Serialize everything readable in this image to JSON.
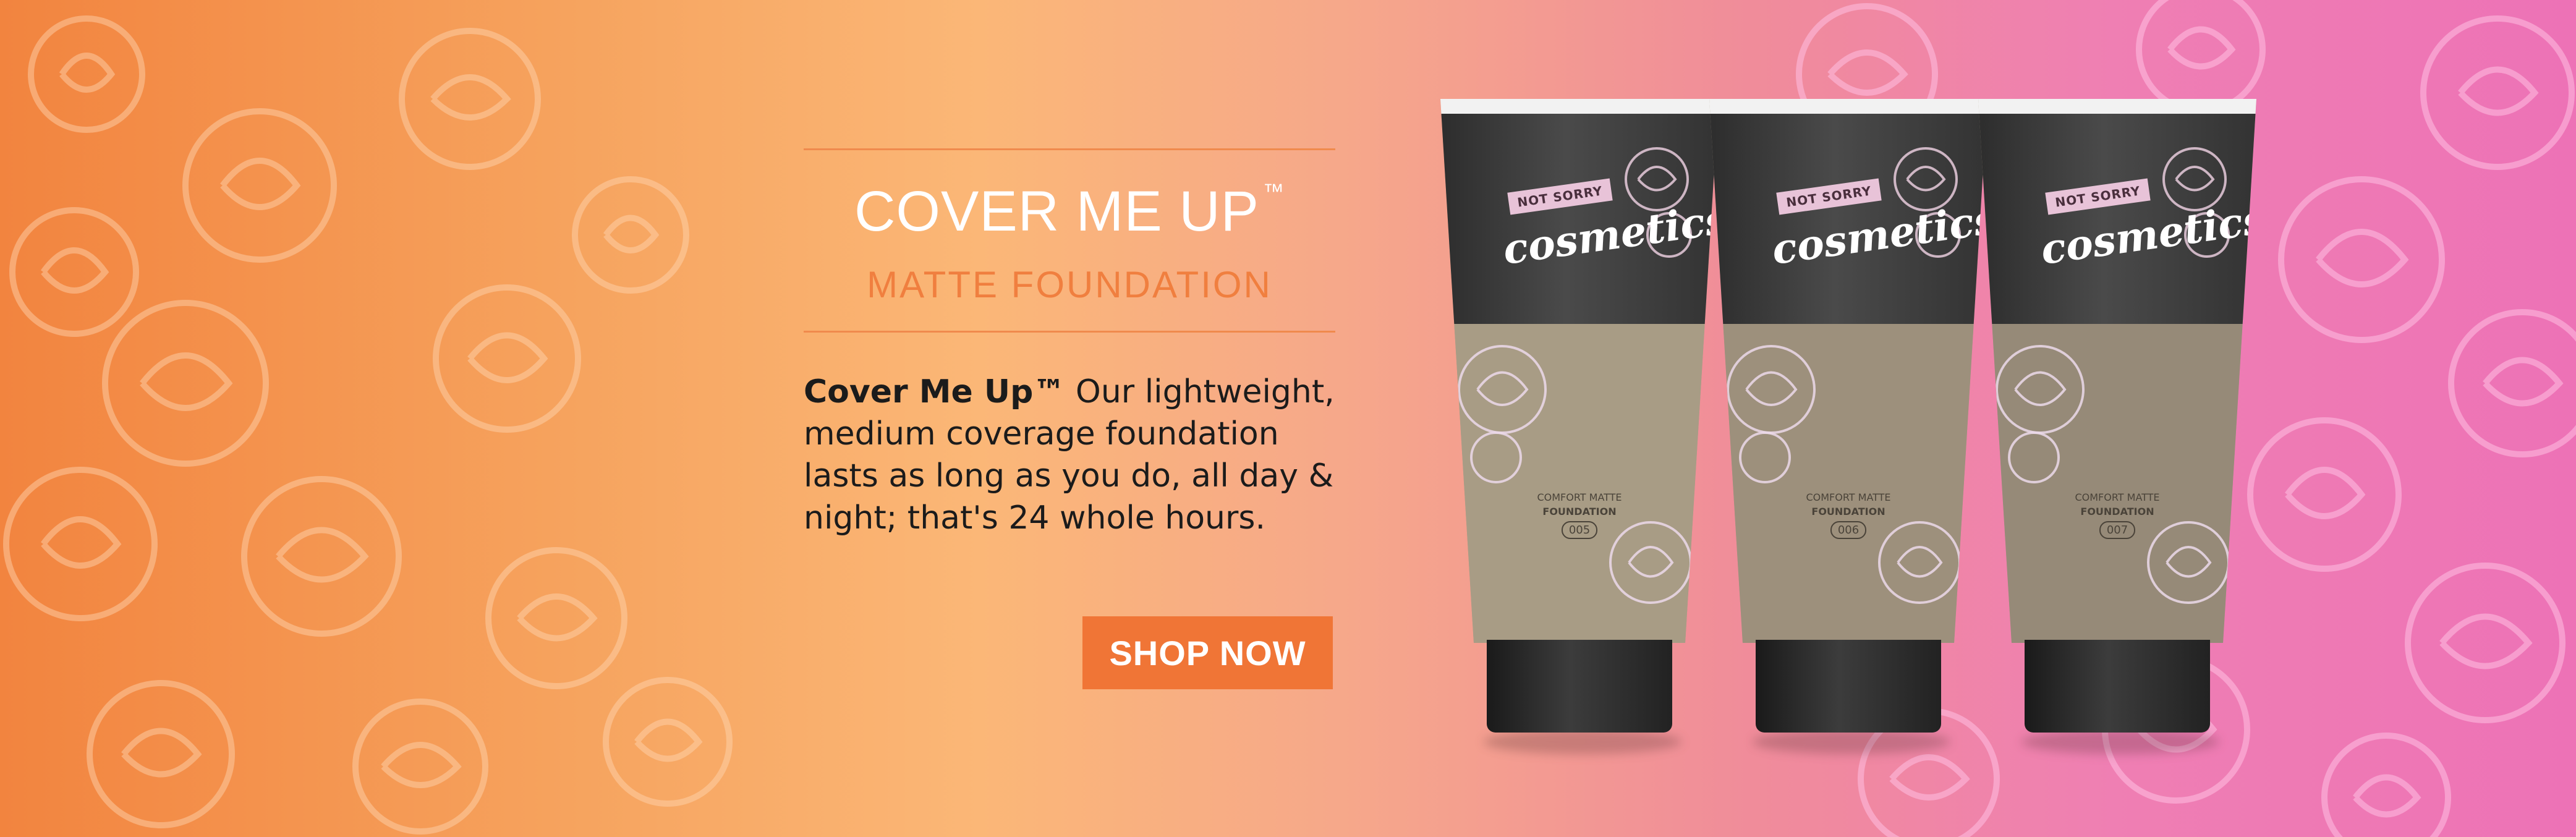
{
  "hero": {
    "title": "COVER ME UP",
    "title_mark": "™",
    "subtitle": "MATTE FOUNDATION",
    "body_lead": "Cover Me Up™",
    "body_text": " Our lightweight, medium coverage foundation lasts as long as you do, all day & night; that's 24 whole hours.",
    "cta_label": "SHOP NOW"
  },
  "products": [
    {
      "brand_tag": "NOT SORRY",
      "brand_name": "cosmetics",
      "line1": "COMFORT MATTE",
      "line2": "FOUNDATION",
      "shade": "005",
      "shade_color": "#a89c85"
    },
    {
      "brand_tag": "NOT SORRY",
      "brand_name": "cosmetics",
      "line1": "COMFORT MATTE",
      "line2": "FOUNDATION",
      "shade": "006",
      "shade_color": "#9d907c"
    },
    {
      "brand_tag": "NOT SORRY",
      "brand_name": "cosmetics",
      "line1": "COMFORT MATTE",
      "line2": "FOUNDATION",
      "shade": "007",
      "shade_color": "#968a78"
    }
  ],
  "colors": {
    "accent": "#f07536",
    "subtitle": "#f07f3f",
    "gradient_left": "#f2843f",
    "gradient_right": "#ed72b6"
  }
}
